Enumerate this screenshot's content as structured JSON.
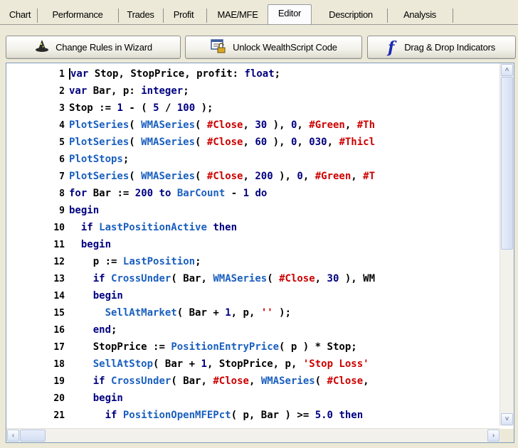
{
  "tabs": [
    {
      "label": "Chart"
    },
    {
      "label": "Performance"
    },
    {
      "label": "Trades"
    },
    {
      "label": "Profit"
    },
    {
      "label": "MAE/MFE"
    },
    {
      "label": "Editor",
      "active": true
    },
    {
      "label": "Description"
    },
    {
      "label": "Analysis"
    }
  ],
  "toolbar": {
    "wizard_label": "Change Rules in Wizard",
    "unlock_label": "Unlock WealthScript Code",
    "dragdrop_label": "Drag & Drop Indicators",
    "dragdrop_glyph": "f"
  },
  "code_lines": [
    {
      "n": "1",
      "text": "var Stop, StopPrice, profit: float;"
    },
    {
      "n": "2",
      "text": "var Bar, p: integer;"
    },
    {
      "n": "3",
      "text": "Stop := 1 - ( 5 / 100 );"
    },
    {
      "n": "4",
      "text": "PlotSeries( WMASeries( #Close, 30 ), 0, #Green, #Th"
    },
    {
      "n": "5",
      "text": "PlotSeries( WMASeries( #Close, 60 ), 0, 030, #Thicl"
    },
    {
      "n": "6",
      "text": "PlotStops;"
    },
    {
      "n": "7",
      "text": "PlotSeries( WMASeries( #Close, 200 ), 0, #Green, #T"
    },
    {
      "n": "8",
      "text": "for Bar := 200 to BarCount - 1 do"
    },
    {
      "n": "9",
      "text": "begin"
    },
    {
      "n": "10",
      "text": "  if LastPositionActive then"
    },
    {
      "n": "11",
      "text": "  begin"
    },
    {
      "n": "12",
      "text": "    p := LastPosition;"
    },
    {
      "n": "13",
      "text": "    if CrossUnder( Bar, WMASeries( #Close, 30 ), WM"
    },
    {
      "n": "14",
      "text": "    begin"
    },
    {
      "n": "15",
      "text": "      SellAtMarket( Bar + 1, p, '' );"
    },
    {
      "n": "16",
      "text": "    end;"
    },
    {
      "n": "17",
      "text": "    StopPrice := PositionEntryPrice( p ) * Stop;"
    },
    {
      "n": "18",
      "text": "    SellAtStop( Bar + 1, StopPrice, p, 'Stop Loss'"
    },
    {
      "n": "19",
      "text": "    if CrossUnder( Bar, #Close, WMASeries( #Close,"
    },
    {
      "n": "20",
      "text": "    begin"
    },
    {
      "n": "21",
      "text": "      if PositionOpenMFEPct( p, Bar ) >= 5.0 then"
    }
  ],
  "colors": {
    "keyword": "#000080",
    "function": "#1a5fbf",
    "string": "#cc0000",
    "identifier": "#000000"
  },
  "icons": {
    "wizard": "wizard-hat-icon",
    "unlock": "unlock-code-icon",
    "dragdrop": "function-f-icon",
    "scroll_up": "arrow-up-icon",
    "scroll_down": "arrow-down-icon",
    "scroll_left": "arrow-left-icon",
    "scroll_right": "arrow-right-icon"
  }
}
